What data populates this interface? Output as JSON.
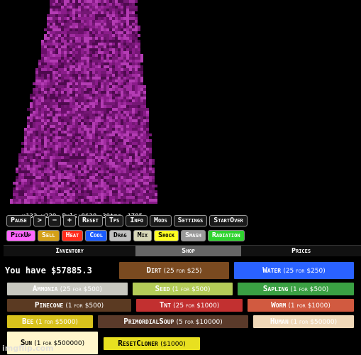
{
  "stats": {
    "coords": "x133,y229",
    "pixels": "Pxls:8638",
    "tps": "30tps",
    "tick": "1785"
  },
  "controls": [
    "Pause",
    ">",
    "−",
    "+",
    "Reset",
    "Tps",
    "Info",
    "Mods",
    "Settings",
    "StartOver"
  ],
  "modes": [
    {
      "label": "PickUp",
      "bg": "#ff66ff",
      "fg": "#000"
    },
    {
      "label": "Sell",
      "bg": "#d4a017",
      "fg": "#fff"
    },
    {
      "label": "Heat",
      "bg": "#ff2a1a",
      "fg": "#fff"
    },
    {
      "label": "Cool",
      "bg": "#1a5cff",
      "fg": "#fff"
    },
    {
      "label": "Drag",
      "bg": "#c0c0c0",
      "fg": "#000"
    },
    {
      "label": "Mix",
      "bg": "#d8d8b8",
      "fg": "#000"
    },
    {
      "label": "Shock",
      "bg": "#ffff22",
      "fg": "#000"
    },
    {
      "label": "Smash",
      "bg": "#999999",
      "fg": "#fff"
    },
    {
      "label": "Radiation",
      "bg": "#2fd32f",
      "fg": "#fff"
    }
  ],
  "tabs": [
    "Inventory",
    "Shop",
    "Prices"
  ],
  "active_tab": "Shop",
  "money_text": "You have $57885.3",
  "shop_items": [
    {
      "name": "Dirt",
      "price": "(25 for $25)",
      "bg": "#7a4a20",
      "fg": "#fff"
    },
    {
      "name": "Water",
      "price": "(25 for $250)",
      "bg": "#2a62ff",
      "fg": "#fff"
    },
    {
      "name": "Ammonia",
      "price": "(25 for $500)",
      "bg": "#c8c8c0",
      "fg": "#fff"
    },
    {
      "name": "Seed",
      "price": "(1 for $500)",
      "bg": "#b4cc58",
      "fg": "#fff"
    },
    {
      "name": "Sapling",
      "price": "(1 for $500)",
      "bg": "#3aa043",
      "fg": "#fff"
    },
    {
      "name": "Pinecone",
      "price": "(1 for $500)",
      "bg": "#5b3a22",
      "fg": "#fff"
    },
    {
      "name": "Tnt",
      "price": "(25 for $1000)",
      "bg": "#c23030",
      "fg": "#fff"
    },
    {
      "name": "Worm",
      "price": "(1 for $1000)",
      "bg": "#d15a40",
      "fg": "#fff"
    },
    {
      "name": "Bee",
      "price": "(1 for $5000)",
      "bg": "#d8c21c",
      "fg": "#fff"
    },
    {
      "name": "PrimordialSoup",
      "price": "(5 for $10000)",
      "bg": "#5a3a2a",
      "fg": "#fff"
    },
    {
      "name": "Human",
      "price": "(1 for $50000)",
      "bg": "#f0d8b8",
      "fg": "#fff"
    },
    {
      "name": "Sun",
      "price": "(1 for $500000)",
      "bg": "#fff6cc",
      "fg": "#000"
    },
    {
      "name": "ResetCloner",
      "price": "($1000)",
      "bg": "#e8e020",
      "fg": "#000"
    }
  ],
  "pixel_colors": [
    "#8a1c8a",
    "#6a106a",
    "#a02ca0",
    "#4e0a4e",
    "#b43cb4",
    "#751875"
  ],
  "watermark": "imgflip.com"
}
